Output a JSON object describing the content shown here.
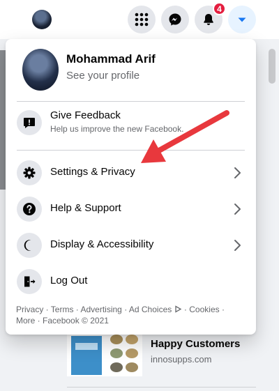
{
  "topbar": {
    "notifications_badge": "4"
  },
  "menu": {
    "profile": {
      "name": "Mohammad Arif",
      "subtitle": "See your profile"
    },
    "feedback": {
      "title": "Give Feedback",
      "subtitle": "Help us improve the new Facebook."
    },
    "items": [
      {
        "label": "Settings & Privacy",
        "icon": "gear-icon"
      },
      {
        "label": "Help & Support",
        "icon": "question-icon"
      },
      {
        "label": "Display & Accessibility",
        "icon": "moon-icon"
      },
      {
        "label": "Log Out",
        "icon": "logout-icon"
      }
    ],
    "footer_links": [
      "Privacy",
      "Terms",
      "Advertising",
      "Ad Choices",
      "Cookies",
      "More"
    ],
    "separator": " · ",
    "copyright": "Facebook © 2021"
  },
  "feed": {
    "ad_title": "Happy Customers",
    "ad_url": "innosupps.com"
  },
  "colors": {
    "accent": "#1877f2",
    "badge": "#e41e3f",
    "arrow": "#e8383d"
  }
}
